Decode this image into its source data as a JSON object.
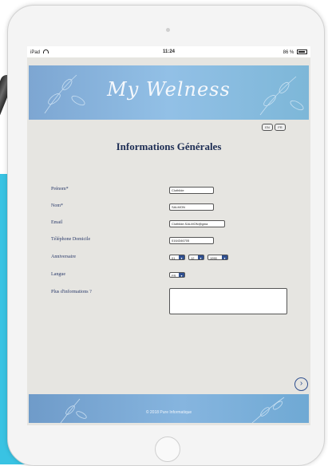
{
  "status_bar": {
    "device": "iPad",
    "time": "11:24",
    "battery": "86 %"
  },
  "banner": {
    "title": "My Welness"
  },
  "language_buttons": [
    "EN",
    "FR"
  ],
  "page": {
    "title": "Informations Générales"
  },
  "form": {
    "first_name": {
      "label": "Prénom*",
      "value": "Clothilde"
    },
    "last_name": {
      "label": "Nom*",
      "value": "SALMON"
    },
    "email": {
      "label": "Email",
      "value": "Clothilde.SALMON@gma"
    },
    "phone": {
      "label": "Téléphone Domicile",
      "value": "0164346705"
    },
    "birthday": {
      "label": "Anniversaire",
      "day": "01",
      "month": "12",
      "year": "1990"
    },
    "language": {
      "label": "Langue",
      "value": "FR"
    },
    "more_info": {
      "label": "Plus d'informations ?",
      "value": ""
    }
  },
  "next_icon": "chevron-right-circle-icon",
  "footer": {
    "text": "© 2018 Pure Informatique"
  },
  "colors": {
    "title": "#1d2d54",
    "accent": "#2f4f8f",
    "banner": "#92c0e6",
    "screen_bg": "#e6e5e1"
  }
}
